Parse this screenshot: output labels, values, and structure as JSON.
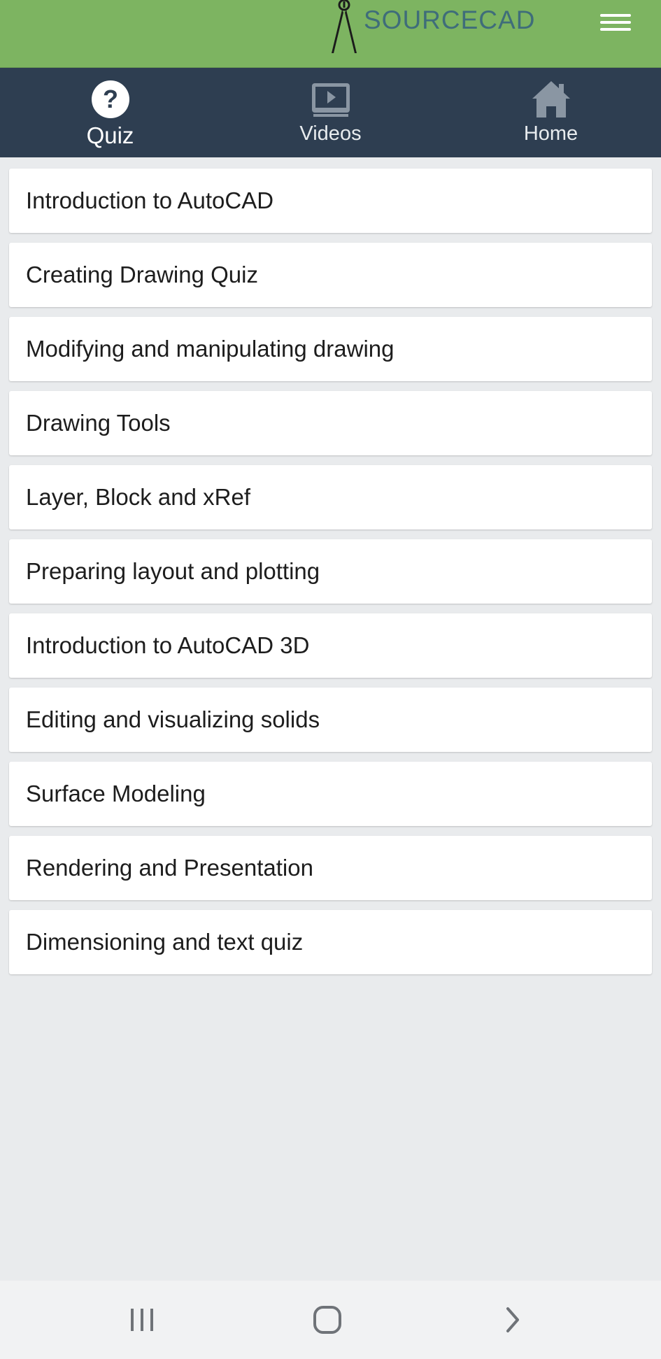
{
  "header": {
    "logo_text": "SOURCECAD",
    "brand_color": "#7db461",
    "logo_text_color": "#3f6d7a"
  },
  "tabs": [
    {
      "label": "Quiz",
      "icon": "question-circle-icon",
      "active": true
    },
    {
      "label": "Videos",
      "icon": "video-player-icon",
      "active": false
    },
    {
      "label": "Home",
      "icon": "home-icon",
      "active": false
    }
  ],
  "tab_bar_color": "#2e3e51",
  "quiz_list": [
    "Introduction to AutoCAD",
    "Creating Drawing Quiz",
    "Modifying and manipulating drawing",
    "Drawing Tools",
    "Layer, Block and xRef",
    "Preparing layout and plotting",
    "Introduction to AutoCAD 3D",
    "Editing and visualizing solids",
    "Surface Modeling",
    "Rendering and Presentation",
    "Dimensioning and text quiz"
  ],
  "system_nav": {
    "buttons": [
      "recent-apps-icon",
      "home-circle-icon",
      "back-chevron-icon"
    ]
  }
}
